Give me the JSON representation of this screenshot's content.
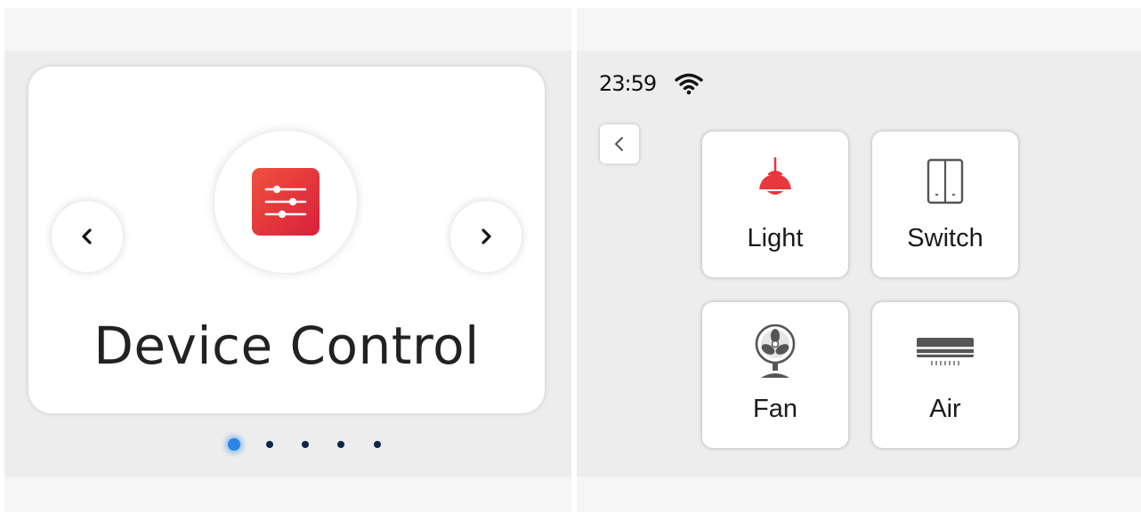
{
  "carousel": {
    "title": "Device Control",
    "feature_icon": "sliders-settings-icon",
    "prev_icon": "chevron-left-icon",
    "next_icon": "chevron-right-icon",
    "page_count": 5,
    "active_page": 1,
    "accent_color": "#e8383d",
    "dot_active_color": "#2b86e5",
    "dot_color": "#0b2746"
  },
  "status_bar": {
    "time": "23:59",
    "wifi_icon": "wifi-icon"
  },
  "back_button": {
    "icon": "chevron-left-icon"
  },
  "devices": [
    {
      "label": "Light",
      "icon": "pendant-lamp-icon",
      "icon_color": "#e8383d"
    },
    {
      "label": "Switch",
      "icon": "wall-switch-icon",
      "icon_color": "#555555"
    },
    {
      "label": "Fan",
      "icon": "desk-fan-icon",
      "icon_color": "#555555"
    },
    {
      "label": "Air",
      "icon": "air-conditioner-icon",
      "icon_color": "#555555"
    }
  ]
}
